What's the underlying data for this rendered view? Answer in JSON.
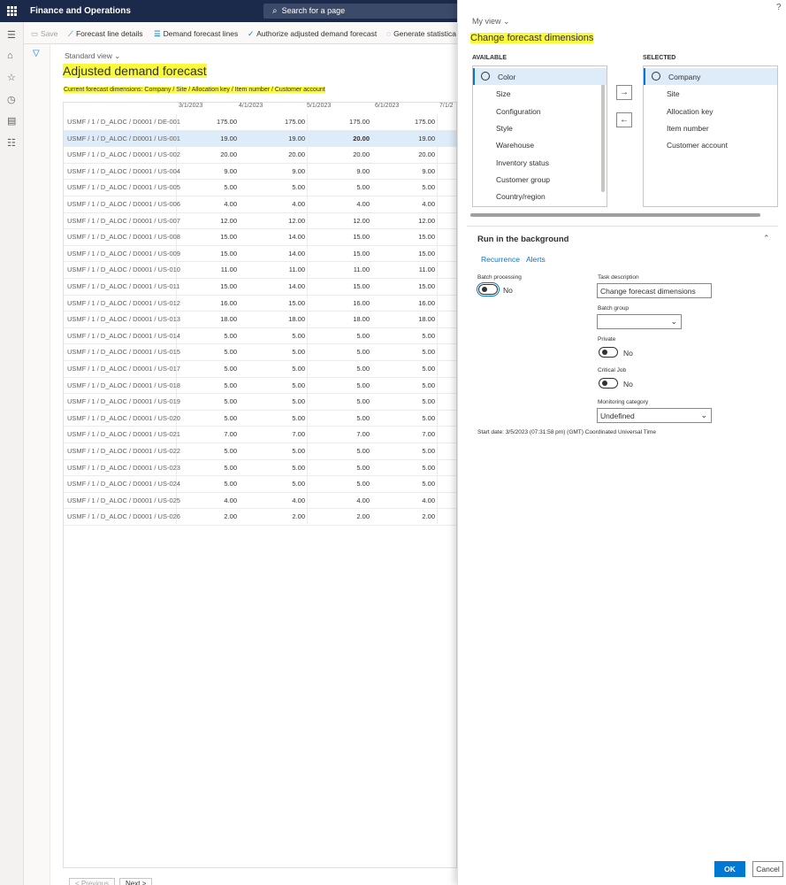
{
  "app": {
    "title": "Finance and Operations",
    "search_placeholder": "Search for a page",
    "help": "?"
  },
  "actions": {
    "save": "Save",
    "forecast_line_details": "Forecast line details",
    "demand_forecast_lines": "Demand forecast lines",
    "authorize": "Authorize adjusted demand forecast",
    "generate": "Generate statistica"
  },
  "page": {
    "view": "Standard view",
    "title": "Adjusted demand forecast",
    "current_dims": "Current forecast dimensions: Company / Site / Allocation key / Item number / Customer account"
  },
  "grid": {
    "dates": [
      "3/1/2023",
      "4/1/2023",
      "5/1/2023",
      "6/1/2023",
      "7/1/2"
    ],
    "rows": [
      {
        "key": "USMF / 1 / D_ALOC / D0001 / DE-001",
        "v": [
          "175.00",
          "175.00",
          "175.00",
          "175.00"
        ]
      },
      {
        "key": "USMF / 1 / D_ALOC / D0001 / US-001",
        "v": [
          "19.00",
          "19.00",
          "20.00",
          "19.00"
        ]
      },
      {
        "key": "USMF / 1 / D_ALOC / D0001 / US-002",
        "v": [
          "20.00",
          "20.00",
          "20.00",
          "20.00"
        ]
      },
      {
        "key": "USMF / 1 / D_ALOC / D0001 / US-004",
        "v": [
          "9.00",
          "9.00",
          "9.00",
          "9.00"
        ]
      },
      {
        "key": "USMF / 1 / D_ALOC / D0001 / US-005",
        "v": [
          "5.00",
          "5.00",
          "5.00",
          "5.00"
        ]
      },
      {
        "key": "USMF / 1 / D_ALOC / D0001 / US-006",
        "v": [
          "4.00",
          "4.00",
          "4.00",
          "4.00"
        ]
      },
      {
        "key": "USMF / 1 / D_ALOC / D0001 / US-007",
        "v": [
          "12.00",
          "12.00",
          "12.00",
          "12.00"
        ]
      },
      {
        "key": "USMF / 1 / D_ALOC / D0001 / US-008",
        "v": [
          "15.00",
          "14.00",
          "15.00",
          "15.00"
        ]
      },
      {
        "key": "USMF / 1 / D_ALOC / D0001 / US-009",
        "v": [
          "15.00",
          "14.00",
          "15.00",
          "15.00"
        ]
      },
      {
        "key": "USMF / 1 / D_ALOC / D0001 / US-010",
        "v": [
          "11.00",
          "11.00",
          "11.00",
          "11.00"
        ]
      },
      {
        "key": "USMF / 1 / D_ALOC / D0001 / US-011",
        "v": [
          "15.00",
          "14.00",
          "15.00",
          "15.00"
        ]
      },
      {
        "key": "USMF / 1 / D_ALOC / D0001 / US-012",
        "v": [
          "16.00",
          "15.00",
          "16.00",
          "16.00"
        ]
      },
      {
        "key": "USMF / 1 / D_ALOC / D0001 / US-013",
        "v": [
          "18.00",
          "18.00",
          "18.00",
          "18.00"
        ]
      },
      {
        "key": "USMF / 1 / D_ALOC / D0001 / US-014",
        "v": [
          "5.00",
          "5.00",
          "5.00",
          "5.00"
        ]
      },
      {
        "key": "USMF / 1 / D_ALOC / D0001 / US-015",
        "v": [
          "5.00",
          "5.00",
          "5.00",
          "5.00"
        ]
      },
      {
        "key": "USMF / 1 / D_ALOC / D0001 / US-017",
        "v": [
          "5.00",
          "5.00",
          "5.00",
          "5.00"
        ]
      },
      {
        "key": "USMF / 1 / D_ALOC / D0001 / US-018",
        "v": [
          "5.00",
          "5.00",
          "5.00",
          "5.00"
        ]
      },
      {
        "key": "USMF / 1 / D_ALOC / D0001 / US-019",
        "v": [
          "5.00",
          "5.00",
          "5.00",
          "5.00"
        ]
      },
      {
        "key": "USMF / 1 / D_ALOC / D0001 / US-020",
        "v": [
          "5.00",
          "5.00",
          "5.00",
          "5.00"
        ]
      },
      {
        "key": "USMF / 1 / D_ALOC / D0001 / US-021",
        "v": [
          "7.00",
          "7.00",
          "7.00",
          "7.00"
        ]
      },
      {
        "key": "USMF / 1 / D_ALOC / D0001 / US-022",
        "v": [
          "5.00",
          "5.00",
          "5.00",
          "5.00"
        ]
      },
      {
        "key": "USMF / 1 / D_ALOC / D0001 / US-023",
        "v": [
          "5.00",
          "5.00",
          "5.00",
          "5.00"
        ]
      },
      {
        "key": "USMF / 1 / D_ALOC / D0001 / US-024",
        "v": [
          "5.00",
          "5.00",
          "5.00",
          "5.00"
        ]
      },
      {
        "key": "USMF / 1 / D_ALOC / D0001 / US-025",
        "v": [
          "4.00",
          "4.00",
          "4.00",
          "4.00"
        ]
      },
      {
        "key": "USMF / 1 / D_ALOC / D0001 / US-026",
        "v": [
          "2.00",
          "2.00",
          "2.00",
          "2.00"
        ]
      }
    ],
    "selected_row": 1,
    "bold_cell": {
      "row": 1,
      "col": 2
    }
  },
  "pager": {
    "previous": "< Previous",
    "next": "Next >"
  },
  "panel": {
    "my_view": "My view",
    "title": "Change forecast dimensions",
    "available_label": "AVAILABLE",
    "selected_label": "SELECTED",
    "available": [
      "Color",
      "Size",
      "Configuration",
      "Style",
      "Warehouse",
      "Inventory status",
      "Customer group",
      "Country/region"
    ],
    "selected": [
      "Company",
      "Site",
      "Allocation key",
      "Item number",
      "Customer account"
    ],
    "add_arrow": "→",
    "remove_arrow": "←",
    "run_bg": "Run in the background",
    "recurrence": "Recurrence",
    "alerts": "Alerts",
    "batch_processing_label": "Batch processing",
    "batch_processing_value": "No",
    "task_description_label": "Task description",
    "task_description_value": "Change forecast dimensions",
    "batch_group_label": "Batch group",
    "batch_group_value": "",
    "private_label": "Private",
    "private_value": "No",
    "critical_label": "Critical Job",
    "critical_value": "No",
    "monitoring_label": "Monitoring category",
    "monitoring_value": "Undefined",
    "start_date": "Start date: 3/5/2023 (07:31:58 pm) (GMT) Coordinated Universal Time",
    "ok": "OK",
    "cancel": "Cancel"
  },
  "colors": {
    "accent": "#0078d4",
    "highlight": "#fafa3a",
    "topbar": "#1b2a4a"
  }
}
